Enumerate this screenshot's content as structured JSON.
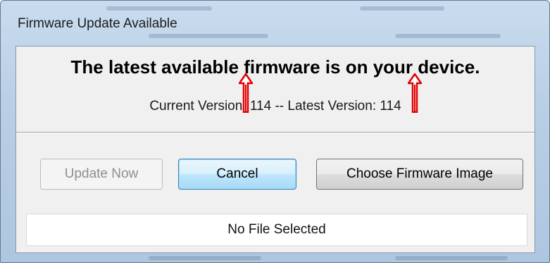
{
  "window": {
    "title": "Firmware Update Available"
  },
  "dialog": {
    "headline": "The latest available firmware is on your device.",
    "version_line": {
      "current_label": "Current Version: ",
      "current_value": "114",
      "separator": " -- ",
      "latest_label": "Latest Version: ",
      "latest_value": "114"
    },
    "buttons": {
      "update_now": "Update Now",
      "cancel": "Cancel",
      "choose_firmware": "Choose Firmware Image"
    },
    "file_status": "No File Selected"
  },
  "annotations": {
    "arrow_color": "#e00000",
    "arrow_style": "double-line up arrow"
  },
  "colors": {
    "title_bar": "#b9cfe6",
    "client_background": "#f0f0f0",
    "cancel_focus_border": "#3c7fb1",
    "disabled_text": "#8f8f8f"
  }
}
